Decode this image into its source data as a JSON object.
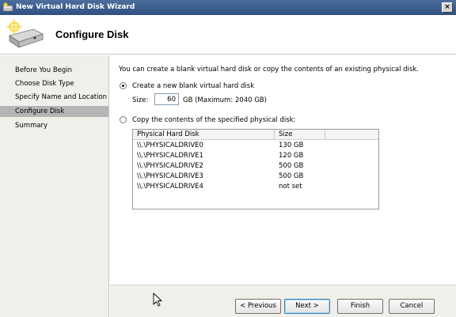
{
  "window": {
    "title": "New Virtual Hard Disk Wizard",
    "close_label": "×"
  },
  "header": {
    "title": "Configure Disk",
    "icon": "hard-disk-sparkle-icon"
  },
  "nav": {
    "items": [
      {
        "label": "Before You Begin",
        "active": false
      },
      {
        "label": "Choose Disk Type",
        "active": false
      },
      {
        "label": "Specify Name and Location",
        "active": false
      },
      {
        "label": "Configure Disk",
        "active": true
      },
      {
        "label": "Summary",
        "active": false
      }
    ]
  },
  "content": {
    "intro": "You can create a blank virtual hard disk or copy the contents of an existing physical disk.",
    "option_new": {
      "label": "Create a new blank virtual hard disk",
      "selected": true
    },
    "size": {
      "label": "Size:",
      "value": "60",
      "suffix": "GB (Maximum: 2040 GB)"
    },
    "option_copy": {
      "label": "Copy the contents of the specified physical disk:",
      "selected": false
    },
    "disk_table": {
      "columns": [
        "Physical Hard Disk",
        "Size"
      ],
      "rows": [
        {
          "disk": "\\\\.\\PHYSICALDRIVE0",
          "size": "130 GB"
        },
        {
          "disk": "\\\\.\\PHYSICALDRIVE1",
          "size": "120 GB"
        },
        {
          "disk": "\\\\.\\PHYSICALDRIVE2",
          "size": "500 GB"
        },
        {
          "disk": "\\\\.\\PHYSICALDRIVE3",
          "size": "500 GB"
        },
        {
          "disk": "\\\\.\\PHYSICALDRIVE4",
          "size": "not set"
        }
      ]
    }
  },
  "footer": {
    "previous": "< Previous",
    "next": "Next >",
    "finish": "Finish",
    "cancel": "Cancel"
  },
  "colors": {
    "titlebar": "#3a5c8c",
    "nav_background": "#f0efe9",
    "nav_active": "#b5b5b5"
  }
}
